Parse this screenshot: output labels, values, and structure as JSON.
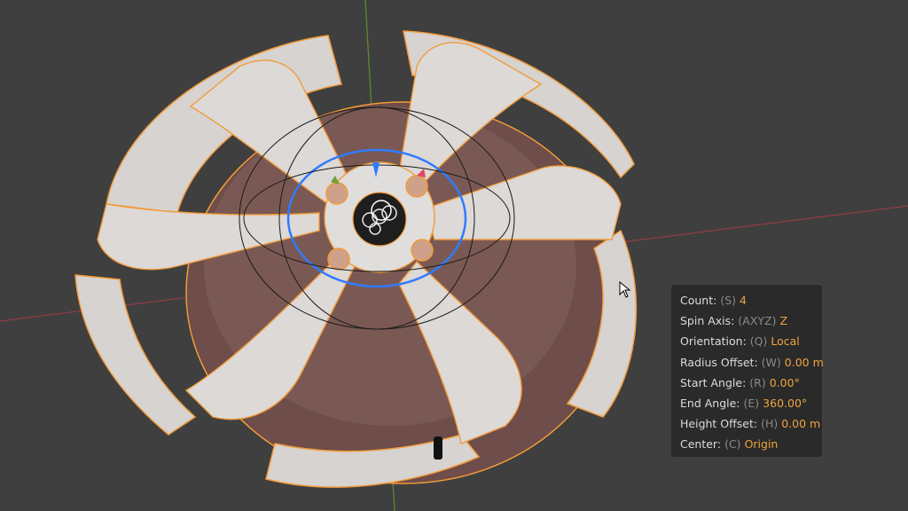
{
  "operator_panel": {
    "rows": [
      {
        "label": "Count:",
        "key": "(S)",
        "value": "4"
      },
      {
        "label": "Spin Axis:",
        "key": "(AXYZ)",
        "value": "Z"
      },
      {
        "label": "Orientation:",
        "key": "(Q)",
        "value": "Local"
      },
      {
        "label": "Radius Offset:",
        "key": "(W)",
        "value": "0.00 m"
      },
      {
        "label": "Start Angle:",
        "key": "(R)",
        "value": "0.00°"
      },
      {
        "label": "End Angle:",
        "key": "(E)",
        "value": "360.00°"
      },
      {
        "label": "Height Offset:",
        "key": "(H)",
        "value": "0.00 m"
      },
      {
        "label": "Center:",
        "key": "(C)",
        "value": "Origin"
      }
    ]
  },
  "colors": {
    "viewport_bg": "#3f3f3f",
    "selection_outline": "#f29b38",
    "value_accent": "#f0a43e",
    "gizmo_ring": "#2f7bff",
    "x_axis": "#a3444c",
    "y_axis": "#6a9a2e",
    "wheel_surface": "#d9d6d4",
    "wheel_shadow": "#7a5a55"
  },
  "icons": {
    "cursor": "mouse-pointer-icon",
    "gizmo": "transform-gizmo-icon"
  }
}
